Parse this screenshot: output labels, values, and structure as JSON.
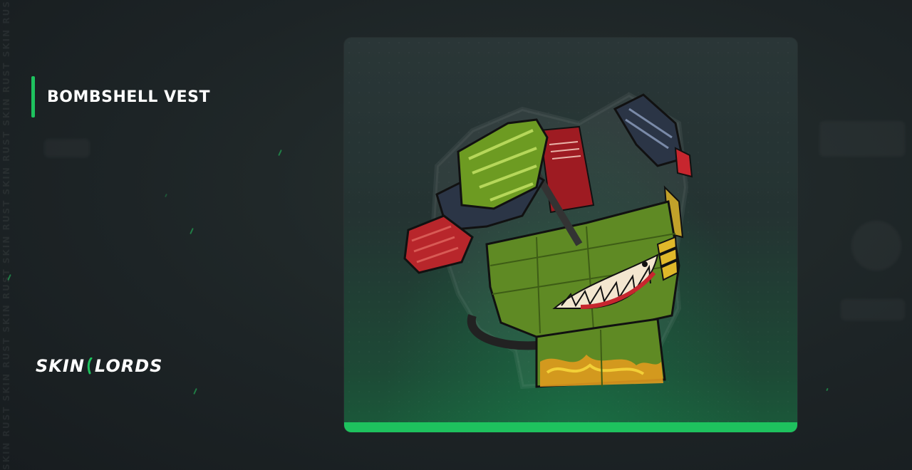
{
  "item": {
    "title": "BOMBSHELL VEST"
  },
  "brand": {
    "logo_text_left": "SKIN",
    "logo_text_right": "LORDS",
    "watermark": "SKIN RUST SKIN RUST SKIN RUST SKIN RUST SKIN RUST SKIN RUST SKIN RUST"
  },
  "colors": {
    "accent": "#1ec25e",
    "background": "#1d2426",
    "card": "#243332"
  },
  "icons": {
    "item_image": "armored-vest-icon",
    "logo_mark": "skinlords-logo-mark-icon"
  }
}
